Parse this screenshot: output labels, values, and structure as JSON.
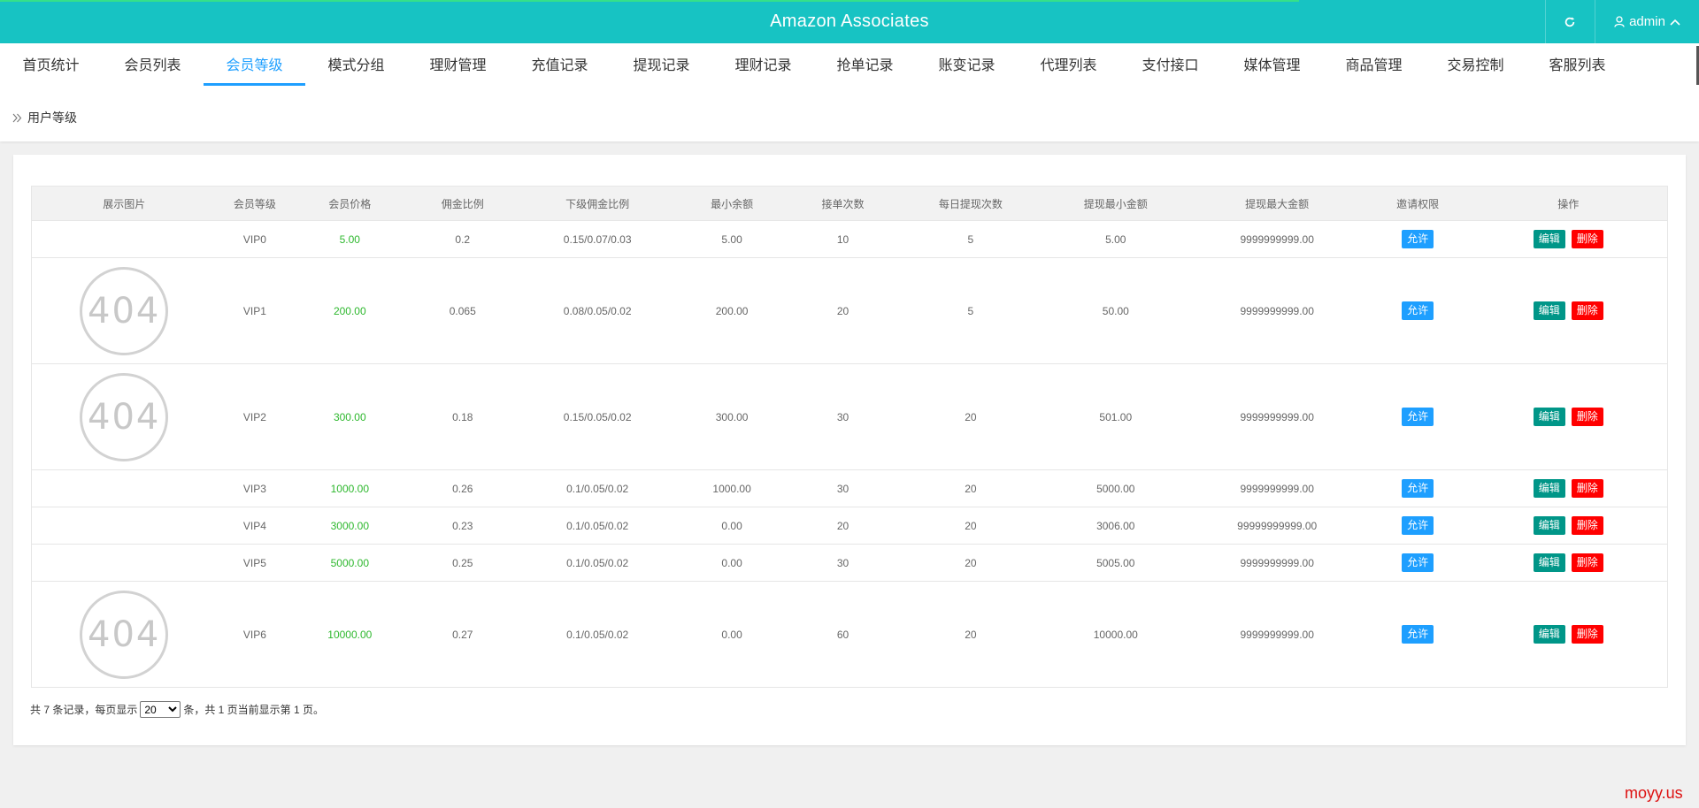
{
  "app": {
    "title": "Amazon Associates",
    "user": "admin"
  },
  "nav": {
    "tabs": [
      "首页统计",
      "会员列表",
      "会员等级",
      "模式分组",
      "理财管理",
      "充值记录",
      "提现记录",
      "理财记录",
      "抢单记录",
      "账变记录",
      "代理列表",
      "支付接口",
      "媒体管理",
      "商品管理",
      "交易控制",
      "客服列表"
    ],
    "active_index": 2,
    "breadcrumb": "用户等级"
  },
  "table": {
    "headers": [
      "展示图片",
      "会员等级",
      "会员价格",
      "佣金比例",
      "下级佣金比例",
      "最小余额",
      "接单次数",
      "每日提现次数",
      "提现最小金额",
      "提现最大金额",
      "邀请权限",
      "操作"
    ],
    "image_placeholder": "404",
    "rows": [
      {
        "image": false,
        "level": "VIP0",
        "price": "5.00",
        "rate": "0.2",
        "sub_rate": "0.15/0.07/0.03",
        "min_balance": "5.00",
        "orders": "10",
        "daily_withdraw": "5",
        "withdraw_min": "5.00",
        "withdraw_max": "9999999999.00",
        "invite": "允许"
      },
      {
        "image": true,
        "level": "VIP1",
        "price": "200.00",
        "rate": "0.065",
        "sub_rate": "0.08/0.05/0.02",
        "min_balance": "200.00",
        "orders": "20",
        "daily_withdraw": "5",
        "withdraw_min": "50.00",
        "withdraw_max": "9999999999.00",
        "invite": "允许"
      },
      {
        "image": true,
        "level": "VIP2",
        "price": "300.00",
        "rate": "0.18",
        "sub_rate": "0.15/0.05/0.02",
        "min_balance": "300.00",
        "orders": "30",
        "daily_withdraw": "20",
        "withdraw_min": "501.00",
        "withdraw_max": "9999999999.00",
        "invite": "允许"
      },
      {
        "image": false,
        "level": "VIP3",
        "price": "1000.00",
        "rate": "0.26",
        "sub_rate": "0.1/0.05/0.02",
        "min_balance": "1000.00",
        "orders": "30",
        "daily_withdraw": "20",
        "withdraw_min": "5000.00",
        "withdraw_max": "9999999999.00",
        "invite": "允许"
      },
      {
        "image": false,
        "level": "VIP4",
        "price": "3000.00",
        "rate": "0.23",
        "sub_rate": "0.1/0.05/0.02",
        "min_balance": "0.00",
        "orders": "20",
        "daily_withdraw": "20",
        "withdraw_min": "3006.00",
        "withdraw_max": "99999999999.00",
        "invite": "允许"
      },
      {
        "image": false,
        "level": "VIP5",
        "price": "5000.00",
        "rate": "0.25",
        "sub_rate": "0.1/0.05/0.02",
        "min_balance": "0.00",
        "orders": "30",
        "daily_withdraw": "20",
        "withdraw_min": "5005.00",
        "withdraw_max": "9999999999.00",
        "invite": "允许"
      },
      {
        "image": true,
        "level": "VIP6",
        "price": "10000.00",
        "rate": "0.27",
        "sub_rate": "0.1/0.05/0.02",
        "min_balance": "0.00",
        "orders": "60",
        "daily_withdraw": "20",
        "withdraw_min": "10000.00",
        "withdraw_max": "9999999999.00",
        "invite": "允许"
      }
    ],
    "actions": {
      "edit": "编辑",
      "delete": "删除"
    }
  },
  "pager": {
    "prefix": "共 7 条记录，每页显示",
    "per_page": "20",
    "per_page_options": [
      "20"
    ],
    "suffix": "条，共 1 页当前显示第 1 页。"
  },
  "watermark": "moyy.us",
  "colors": {
    "header": "#17c3c3",
    "active_tab": "#1e9fff",
    "price": "#2eb82e",
    "allow": "#1e9fff",
    "edit": "#009688",
    "delete": "#ff0000"
  }
}
